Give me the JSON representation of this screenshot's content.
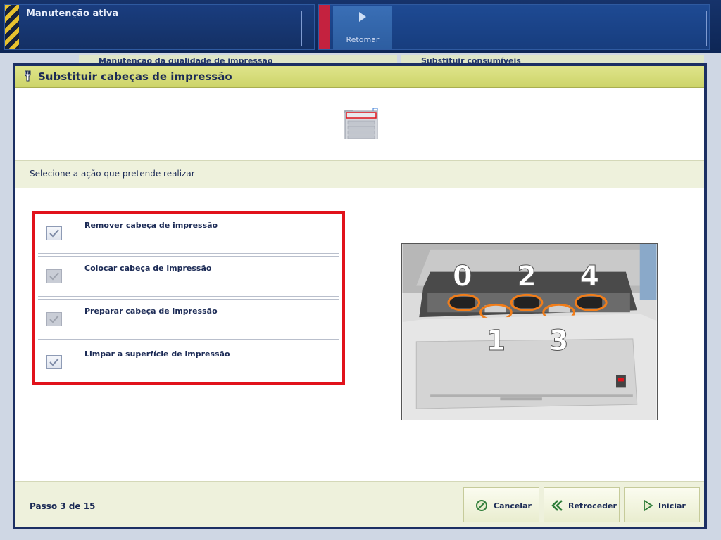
{
  "status_bar": {
    "maintenance_title": "Manutenção ativa",
    "resume_label": "Retomar"
  },
  "background_tabs": {
    "left": "Manutenção da qualidade de impressão",
    "right": "Substituir consumíveis"
  },
  "dialog": {
    "title": "Substituir cabeças de impressão",
    "header_icon": "wrench-icon",
    "illustration_icon": "printer-icon",
    "prompt": "Selecione a ação que pretende realizar",
    "options": [
      {
        "label": "Remover cabeça de impressão",
        "checked": true,
        "enabled": true
      },
      {
        "label": "Colocar cabeça de impressão",
        "checked": true,
        "enabled": false
      },
      {
        "label": "Preparar cabeça de impressão",
        "checked": true,
        "enabled": false
      },
      {
        "label": "Limpar a superfície de impressão",
        "checked": true,
        "enabled": true
      }
    ],
    "photo_labels": [
      "0",
      "1",
      "2",
      "3",
      "4"
    ],
    "step": "Passo 3 de 15",
    "buttons": {
      "cancel": "Cancelar",
      "back": "Retroceder",
      "start": "Iniciar"
    }
  },
  "colors": {
    "header_bar": "#dfe48a",
    "highlight_border": "#e1121b",
    "callout_orange": "#f07d1a",
    "text_navy": "#1b2a55"
  }
}
